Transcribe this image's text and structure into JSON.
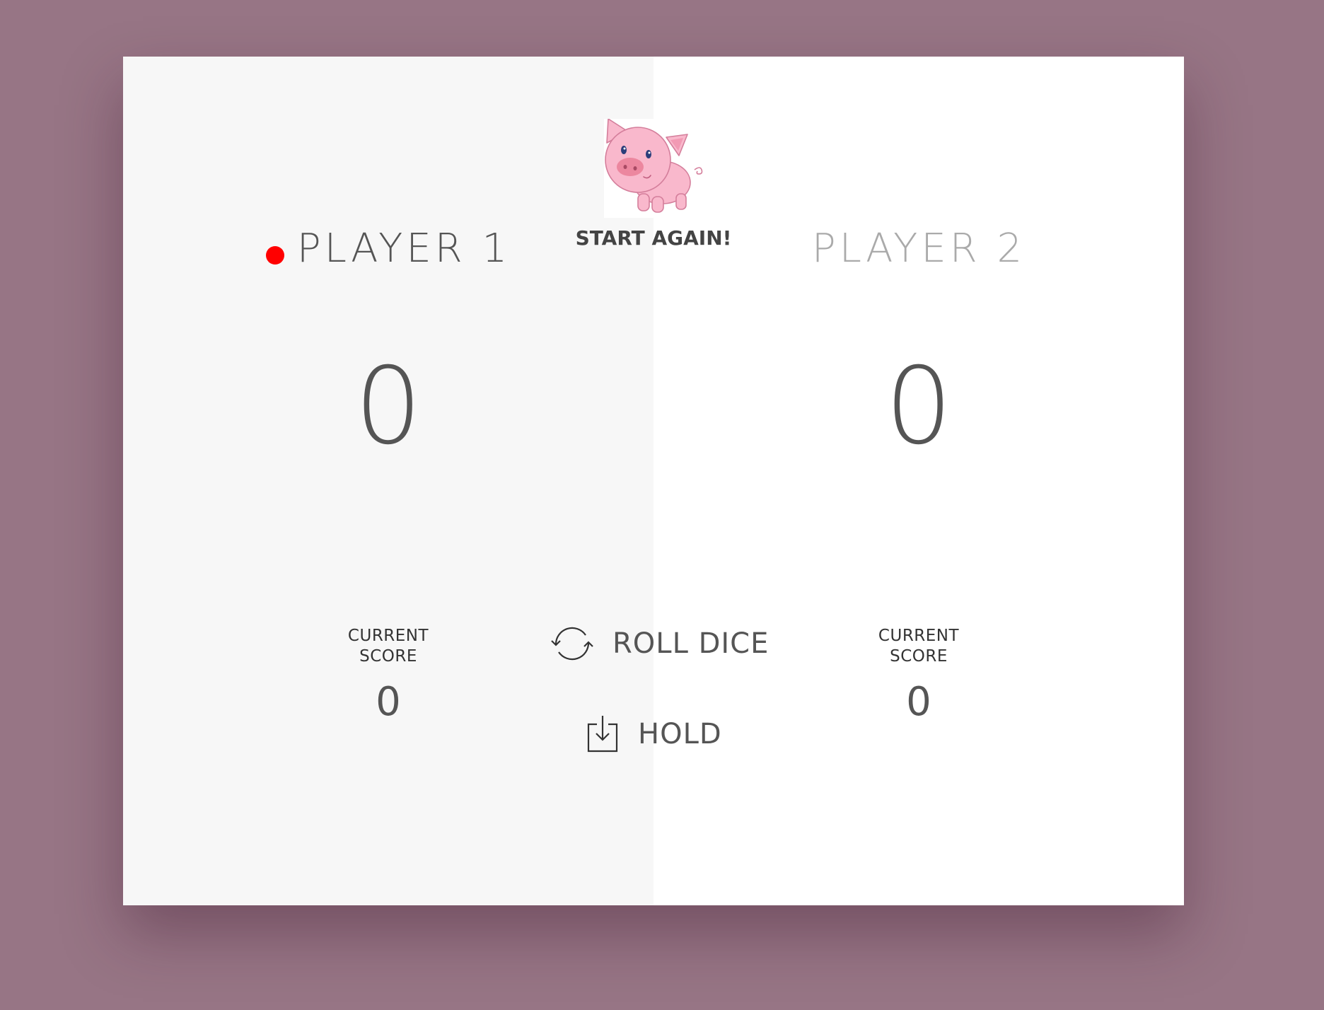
{
  "players": [
    {
      "name": "PLAYER 1",
      "score": "0",
      "current_label": "CURRENT SCORE",
      "current_score": "0",
      "active": true
    },
    {
      "name": "PLAYER 2",
      "score": "0",
      "current_label": "CURRENT SCORE",
      "current_score": "0",
      "active": false
    }
  ],
  "controls": {
    "new_game_label": "START AGAIN!",
    "roll_label": "ROLL DICE",
    "hold_label": "HOLD"
  },
  "icons": {
    "logo": "pig-logo-icon",
    "active_indicator": "active-player-dot-icon",
    "roll": "refresh-icon",
    "hold": "download-box-icon"
  },
  "colors": {
    "background": "#977585",
    "active_panel": "#f7f7f7",
    "inactive_panel": "#ffffff",
    "active_dot": "#ff0000",
    "pig": "#f9b8cc"
  }
}
